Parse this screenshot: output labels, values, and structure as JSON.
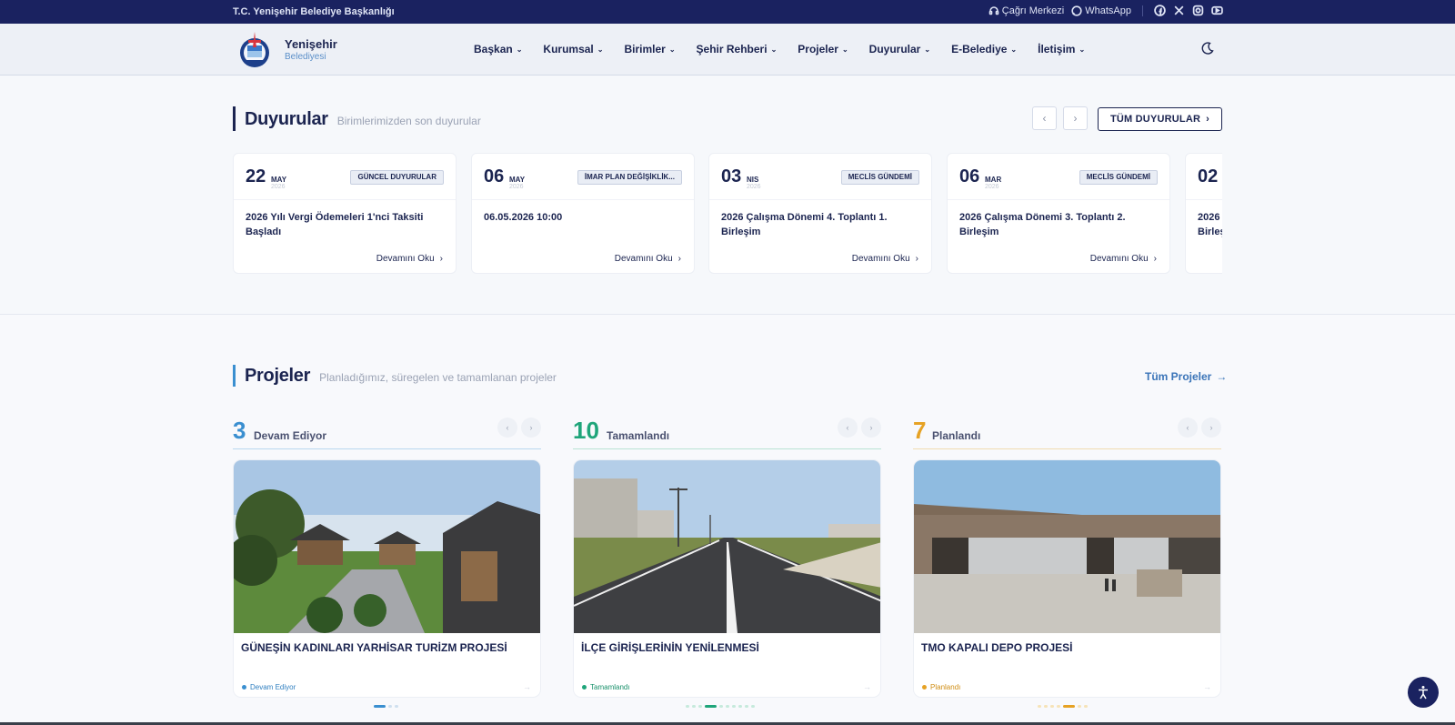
{
  "topbar": {
    "org": "T.C. Yenişehir Belediye Başkanlığı",
    "call_center": "Çağrı Merkezi",
    "whatsapp": "WhatsApp",
    "social_icons": [
      "facebook-icon",
      "x-icon",
      "instagram-icon",
      "youtube-icon"
    ]
  },
  "header": {
    "brand_name": "Yenişehir",
    "brand_sub": "Belediyesi",
    "nav": [
      "Başkan",
      "Kurumsal",
      "Birimler",
      "Şehir Rehberi",
      "Projeler",
      "Duyurular",
      "E-Belediye",
      "İletişim"
    ],
    "theme_icon": "moon-icon"
  },
  "announcements": {
    "title": "Duyurular",
    "subtitle": "Birimlerimizden son duyurular",
    "all_label": "TÜM DUYURULAR",
    "more_label": "Devamını Oku",
    "items": [
      {
        "day": "22",
        "month": "MAY",
        "year": "2026",
        "tag": "GÜNCEL DUYURULAR",
        "title": "2026 Yılı Vergi Ödemeleri 1'nci Taksiti Başladı"
      },
      {
        "day": "06",
        "month": "MAY",
        "year": "2026",
        "tag": "İMAR PLAN DEĞİŞİKLİK...",
        "title": "06.05.2026 10:00"
      },
      {
        "day": "03",
        "month": "NIS",
        "year": "2026",
        "tag": "MECLİS GÜNDEMİ",
        "title": "2026 Çalışma Dönemi 4. Toplantı 1. Birleşim"
      },
      {
        "day": "06",
        "month": "MAR",
        "year": "2026",
        "tag": "MECLİS GÜNDEMİ",
        "title": "2026 Çalışma Dönemi 3. Toplantı 2. Birleşim"
      },
      {
        "day": "02",
        "month": "",
        "year": "",
        "tag": "",
        "title": "2026 Birleş"
      }
    ]
  },
  "projects": {
    "title": "Projeler",
    "subtitle": "Planladığımız, süregelen ve tamamlanan projeler",
    "all_label": "Tüm Projeler",
    "columns": [
      {
        "count": "3",
        "label": "Devam Ediyor",
        "color": "#3a8fd0",
        "card_title": "GÜNEŞİN KADINLARI YARHİSAR TURİZM PROJESİ",
        "status": "Devam Ediyor",
        "status_color": "#2f7fc0"
      },
      {
        "count": "10",
        "label": "Tamamlandı",
        "color": "#1fa57a",
        "card_title": "İLÇE GİRİŞLERİNİN YENİLENMESİ",
        "status": "Tamamlandı",
        "status_color": "#17906a"
      },
      {
        "count": "7",
        "label": "Planlandı",
        "color": "#e6a224",
        "card_title": "TMO KAPALI DEPO PROJESİ",
        "status": "Planlandı",
        "status_color": "#d08e14"
      }
    ]
  },
  "colors": {
    "navy": "#1a2260",
    "brand_blue": "#5b8fc9"
  }
}
